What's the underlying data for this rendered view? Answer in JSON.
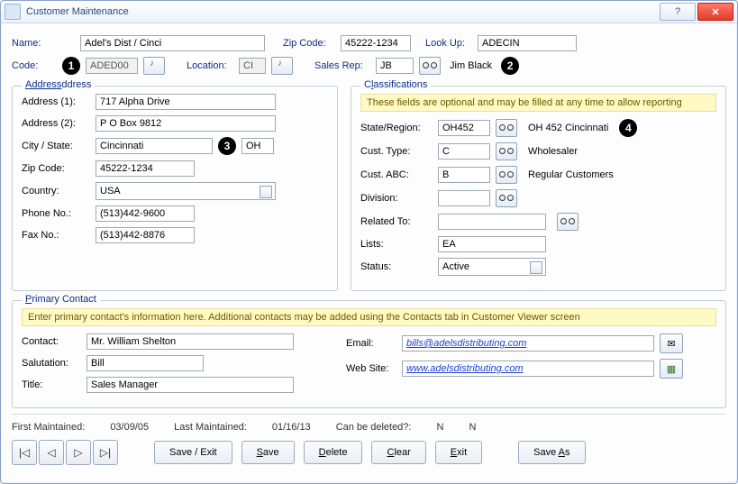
{
  "window_title": "Customer Maintenance",
  "callouts": {
    "c1": "1",
    "c2": "2",
    "c3": "3",
    "c4": "4"
  },
  "header": {
    "name_label": "Name:",
    "name_value": "Adel's Dist / Cinci",
    "zip_label": "Zip Code:",
    "zip_value": "45222-1234",
    "lookup_label": "Look Up:",
    "lookup_value": "ADECIN",
    "code_label": "Code:",
    "code_value": "ADED00",
    "location_label": "Location:",
    "location_value": "CI",
    "salesrep_label": "Sales Rep:",
    "salesrep_value": "JB",
    "salesrep_name": "Jim Black"
  },
  "address": {
    "legend": "Address",
    "addr1_label": "Address (1):",
    "addr1_value": "717 Alpha Drive",
    "addr2_label": "Address (2):",
    "addr2_value": "P O Box 9812",
    "citystate_label": "City / State:",
    "city_value": "Cincinnati",
    "state_value": "OH",
    "zip_label": "Zip Code:",
    "zip_value": "45222-1234",
    "country_label": "Country:",
    "country_value": "USA",
    "phone_label": "Phone No.:",
    "phone_value": "(513)442-9600",
    "fax_label": "Fax No.:",
    "fax_value": "(513)442-8876"
  },
  "class": {
    "legend_pre": "C",
    "legend_ul": "l",
    "legend_post": "assifications",
    "hint": "These fields are optional and may be filled at any time to allow reporting",
    "state_label": "State/Region:",
    "state_value": "OH452",
    "state_desc": "OH 452 Cincinnati",
    "type_label": "Cust. Type:",
    "type_value": "C",
    "type_desc": "Wholesaler",
    "abc_label": "Cust. ABC:",
    "abc_value": "B",
    "abc_desc": "Regular Customers",
    "div_label": "Division:",
    "div_value": "",
    "related_label": "Related To:",
    "related_value": "",
    "lists_label": "Lists:",
    "lists_value": "EA",
    "status_label": "Status:",
    "status_value": "Active"
  },
  "contact": {
    "legend_ul": "P",
    "legend_post": "rimary Contact",
    "hint": "Enter primary contact's information here. Additional contacts may be added using the Contacts tab in Customer Viewer screen",
    "contact_label": "Contact:",
    "contact_value": "Mr. William Shelton",
    "salutation_label": "Salutation:",
    "salutation_value": "Bill",
    "title_label": "Title:",
    "title_value": "Sales Manager",
    "email_label": "Email:",
    "email_value": "bills@adelsdistributing.com",
    "web_label": "Web Site:",
    "web_value": "www.adelsdistributing.com"
  },
  "footer": {
    "first_label": "First Maintained:",
    "first_value": "03/09/05",
    "last_label": "Last Maintained:",
    "last_value": "01/16/13",
    "del_label": "Can be deleted?:",
    "del_v1": "N",
    "del_v2": "N"
  },
  "buttons": {
    "save_exit": "Save / Exit",
    "save": "Save",
    "delete": "Delete",
    "clear": "Clear",
    "exit": "Exit",
    "save_as": "Save As"
  }
}
